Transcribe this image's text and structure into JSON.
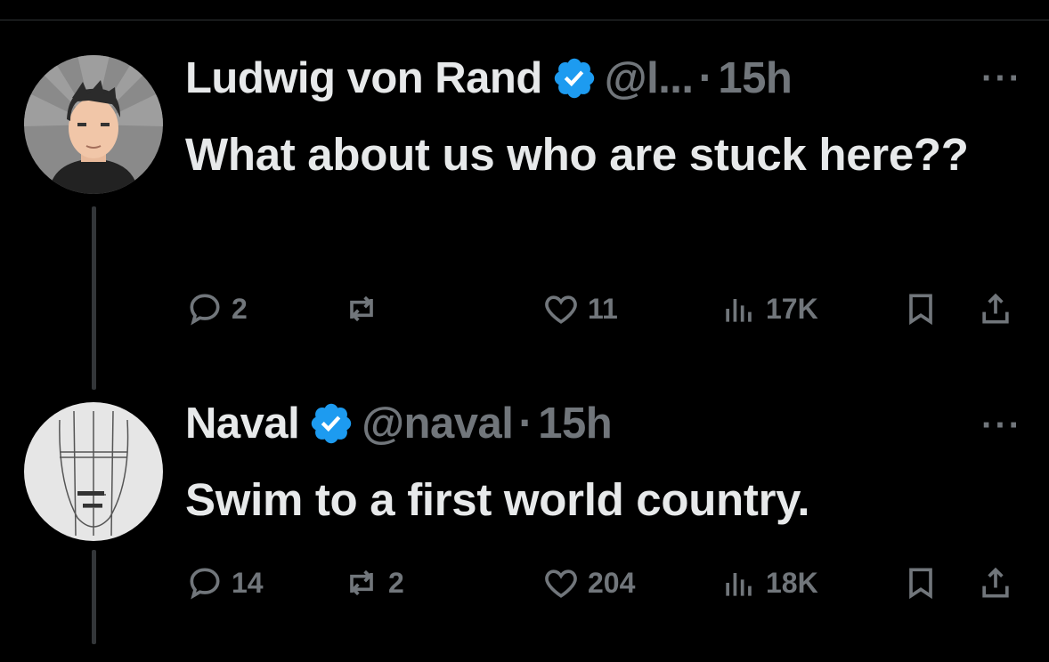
{
  "tweets": [
    {
      "name": "Ludwig von Rand",
      "handle": "@l...",
      "dot": "·",
      "time": "15h",
      "more": "···",
      "text": "What about us who are stuck here??",
      "verified": true,
      "actions": {
        "replies": "2",
        "reposts": "",
        "likes": "11",
        "views": "17K"
      }
    },
    {
      "name": "Naval",
      "handle": "@naval",
      "dot": "·",
      "time": "15h",
      "more": "···",
      "text": "Swim to a first world country.",
      "verified": true,
      "actions": {
        "replies": "14",
        "reposts": "2",
        "likes": "204",
        "views": "18K"
      }
    }
  ],
  "icons": {
    "reply": "reply-icon",
    "repost": "repost-icon",
    "like": "heart-icon",
    "views": "views-icon",
    "bookmark": "bookmark-icon",
    "share": "share-icon",
    "verified": "verified-badge-icon"
  },
  "colors": {
    "background": "#000000",
    "text": "#e7e9ea",
    "muted": "#71767b",
    "verified": "#1d9bf0"
  }
}
